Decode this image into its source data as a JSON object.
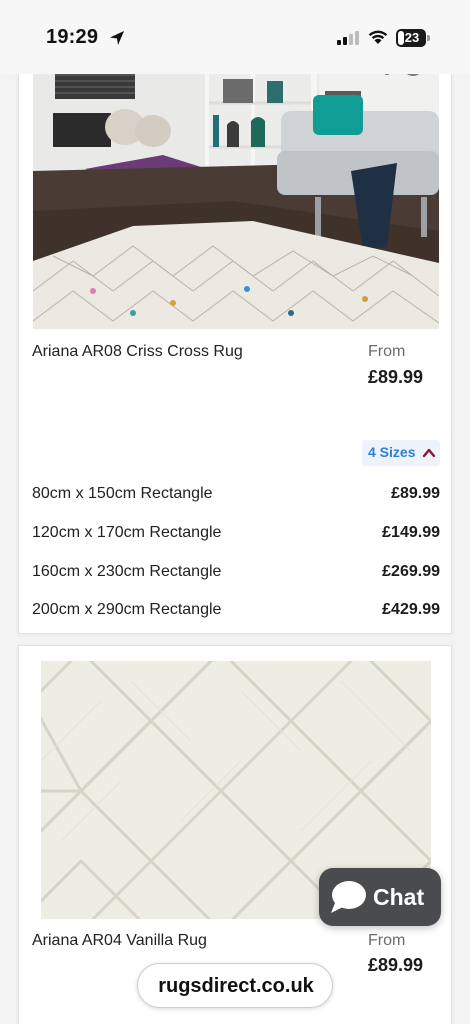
{
  "status_bar": {
    "time": "19:29",
    "battery": "23"
  },
  "products": [
    {
      "title": "Ariana AR08 Criss Cross Rug",
      "from_label": "From",
      "from_price": "£89.99",
      "sizes_toggle": "4 Sizes",
      "sizes": [
        {
          "name": "80cm x 150cm Rectangle",
          "price": "£89.99"
        },
        {
          "name": "120cm x 170cm Rectangle",
          "price": "£149.99"
        },
        {
          "name": "160cm x 230cm Rectangle",
          "price": "£269.99"
        },
        {
          "name": "200cm x 290cm Rectangle",
          "price": "£429.99"
        }
      ]
    },
    {
      "title": "Ariana AR04 Vanilla Rug",
      "from_label": "From",
      "from_price": "£89.99"
    }
  ],
  "chat": {
    "label": "Chat"
  },
  "browser": {
    "domain": "rugsdirect.co.uk"
  },
  "colors": {
    "accent": "#2b7fd4",
    "chevron": "#8a1538",
    "chat_bg": "#4a4b4e"
  }
}
